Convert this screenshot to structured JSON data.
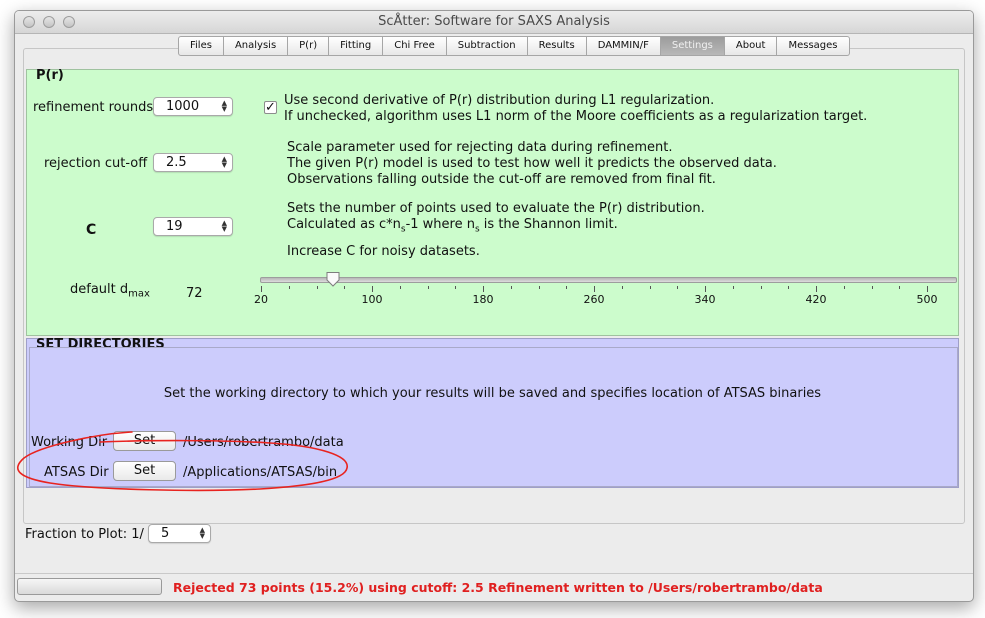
{
  "window": {
    "title": "ScÅtter: Software for SAXS Analysis"
  },
  "tabs": [
    {
      "label": "Files",
      "active": false
    },
    {
      "label": "Analysis",
      "active": false
    },
    {
      "label": "P(r)",
      "active": false
    },
    {
      "label": "Fitting",
      "active": false
    },
    {
      "label": "Chi Free",
      "active": false
    },
    {
      "label": "Subtraction",
      "active": false
    },
    {
      "label": "Results",
      "active": false
    },
    {
      "label": "DAMMIN/F",
      "active": false
    },
    {
      "label": "Settings",
      "active": true
    },
    {
      "label": "About",
      "active": false
    },
    {
      "label": "Messages",
      "active": false
    }
  ],
  "pr": {
    "title": "P(r)",
    "refinement_label": "refinement rounds",
    "refinement_value": "1000",
    "second_derivative_checked": true,
    "second_derivative_line1": "Use second derivative of P(r) distribution during L1 regularization.",
    "second_derivative_line2": "If unchecked, algorithm uses L1 norm of the Moore coefficients as a regularization target.",
    "rejection_label": "rejection cut-off",
    "rejection_value": "2.5",
    "rejection_line1": "Scale parameter used for rejecting data during refinement.",
    "rejection_line2": "The given P(r) model is used to test how well it predicts the observed data.",
    "rejection_line3": "Observations falling outside the cut-off are removed from final fit.",
    "c_label": "C",
    "c_value": "19",
    "c_line1": "Sets the number of points used to evaluate the P(r) distribution.",
    "c_line2_a": "Calculated as c*n",
    "c_line2_sub1": "s",
    "c_line2_b": "-1 where n",
    "c_line2_sub2": "s",
    "c_line2_c": " is the Shannon limit.",
    "c_line3": "Increase C for noisy datasets.",
    "dmax_label": "default d",
    "dmax_sub": "max",
    "dmax_value": "72",
    "slider_min": 20,
    "slider_max": 520,
    "slider_ticks": [
      "20",
      "100",
      "180",
      "260",
      "340",
      "420",
      "500"
    ]
  },
  "dirs": {
    "title": "SET DIRECTORIES",
    "info": "Set the working directory to which your results will be saved and specifies location of ATSAS binaries",
    "working_label": "Working Dir",
    "working_button": "Set",
    "working_path": "/Users/robertrambo/data",
    "atsas_label": "ATSAS Dir",
    "atsas_button": "Set",
    "atsas_path": "/Applications/ATSAS/bin"
  },
  "fraction": {
    "label": "Fraction to Plot: 1/",
    "value": "5"
  },
  "status": {
    "message": "Rejected 73 points (15.2%) using cutoff: 2.5 Refinement written to /Users/robertrambo/data"
  },
  "annotation": {
    "color": "#e8231f"
  }
}
